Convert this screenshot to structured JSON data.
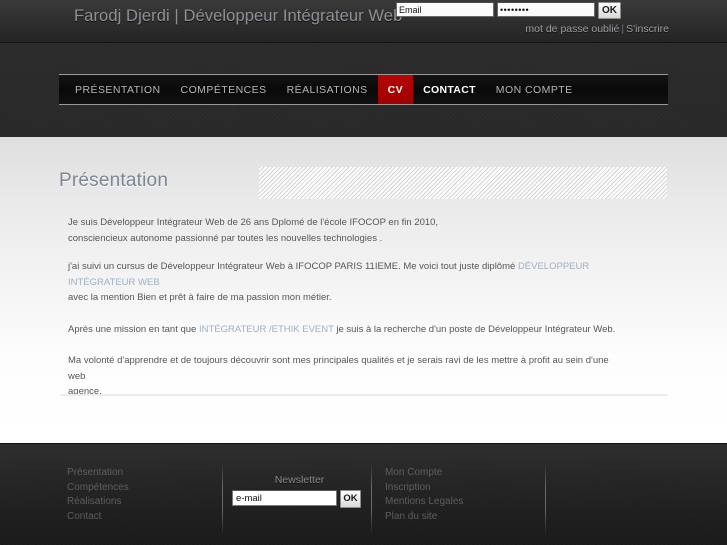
{
  "header": {
    "site_title": "Farodj Djerdi | Développeur Intégrateur Web",
    "login": {
      "email_value": "Email",
      "email_placeholder": "Email",
      "password_value": "••••••••",
      "password_placeholder": "",
      "submit_label": "OK"
    },
    "forgot_password_label": "mot de passe oublié",
    "separator": "|",
    "register_label": "S'inscrire"
  },
  "nav": {
    "items": [
      {
        "label": "PRÉSENTATION",
        "state": "normal"
      },
      {
        "label": "COMPÉTENCES",
        "state": "normal"
      },
      {
        "label": "RÉALISATIONS",
        "state": "normal"
      },
      {
        "label": "CV",
        "state": "active"
      },
      {
        "label": "CONTACT",
        "state": "hover"
      },
      {
        "label": "MON COMPTE",
        "state": "normal"
      }
    ],
    "active_color": "#b00000"
  },
  "main": {
    "page_title": "Présentation",
    "title_color": "#7b8695",
    "link_color": "#9fb0c4",
    "paragraphs": [
      {
        "id": "p1",
        "segments": [
          {
            "type": "text",
            "text": "Je suis Développeur Intégrateur Web de 26 ans Dplomé de l'école IFOCOP en fin 2010,"
          },
          {
            "type": "break"
          },
          {
            "type": "text",
            "text": "consciencieux autonome passionné par toutes les nouvelles technologies ."
          }
        ]
      },
      {
        "id": "p2",
        "segments": [
          {
            "type": "text",
            "text": "j'ai suivi un cursus de Développeur Intégrateur Web à IFOCOP PARIS 11IEME.  Me voici tout juste diplômé "
          },
          {
            "type": "link",
            "text": "DÉVELOPPEUR INTÉGRATEUR WEB"
          },
          {
            "type": "break"
          },
          {
            "type": "text",
            "text": "avec la mention Bien et prêt à faire de ma passion mon métier."
          }
        ]
      },
      {
        "id": "p3",
        "segments": [
          {
            "type": "text",
            "text": "Après une mission en tant que "
          },
          {
            "type": "link",
            "text": "INTÉGRATEUR /ETHIK EVENT"
          },
          {
            "type": "text",
            "text": "  je suis à la recherche d'un poste de Développeur Intégrateur Web."
          }
        ]
      },
      {
        "id": "p4",
        "segments": [
          {
            "type": "text",
            "text": "Ma volonté d'apprendre et de toujours découvrir sont mes principales qualités et je serais ravi de les mettre à profit au sein d'une web"
          },
          {
            "type": "break"
          },
          {
            "type": "text",
            "text": "agence."
          }
        ]
      }
    ]
  },
  "footer": {
    "col_left": [
      {
        "label": "Présentation"
      },
      {
        "label": "Compétences"
      },
      {
        "label": "Réalisations"
      },
      {
        "label": "Contact"
      }
    ],
    "newsletter": {
      "title": "Newsletter",
      "input_value": "e-mail",
      "input_placeholder": "e-mail",
      "submit_label": "OK"
    },
    "col_right": [
      {
        "label": "Mon Compte"
      },
      {
        "label": "Inscription"
      },
      {
        "label": "Mentions Legales"
      },
      {
        "label": "Plan du site"
      }
    ]
  }
}
